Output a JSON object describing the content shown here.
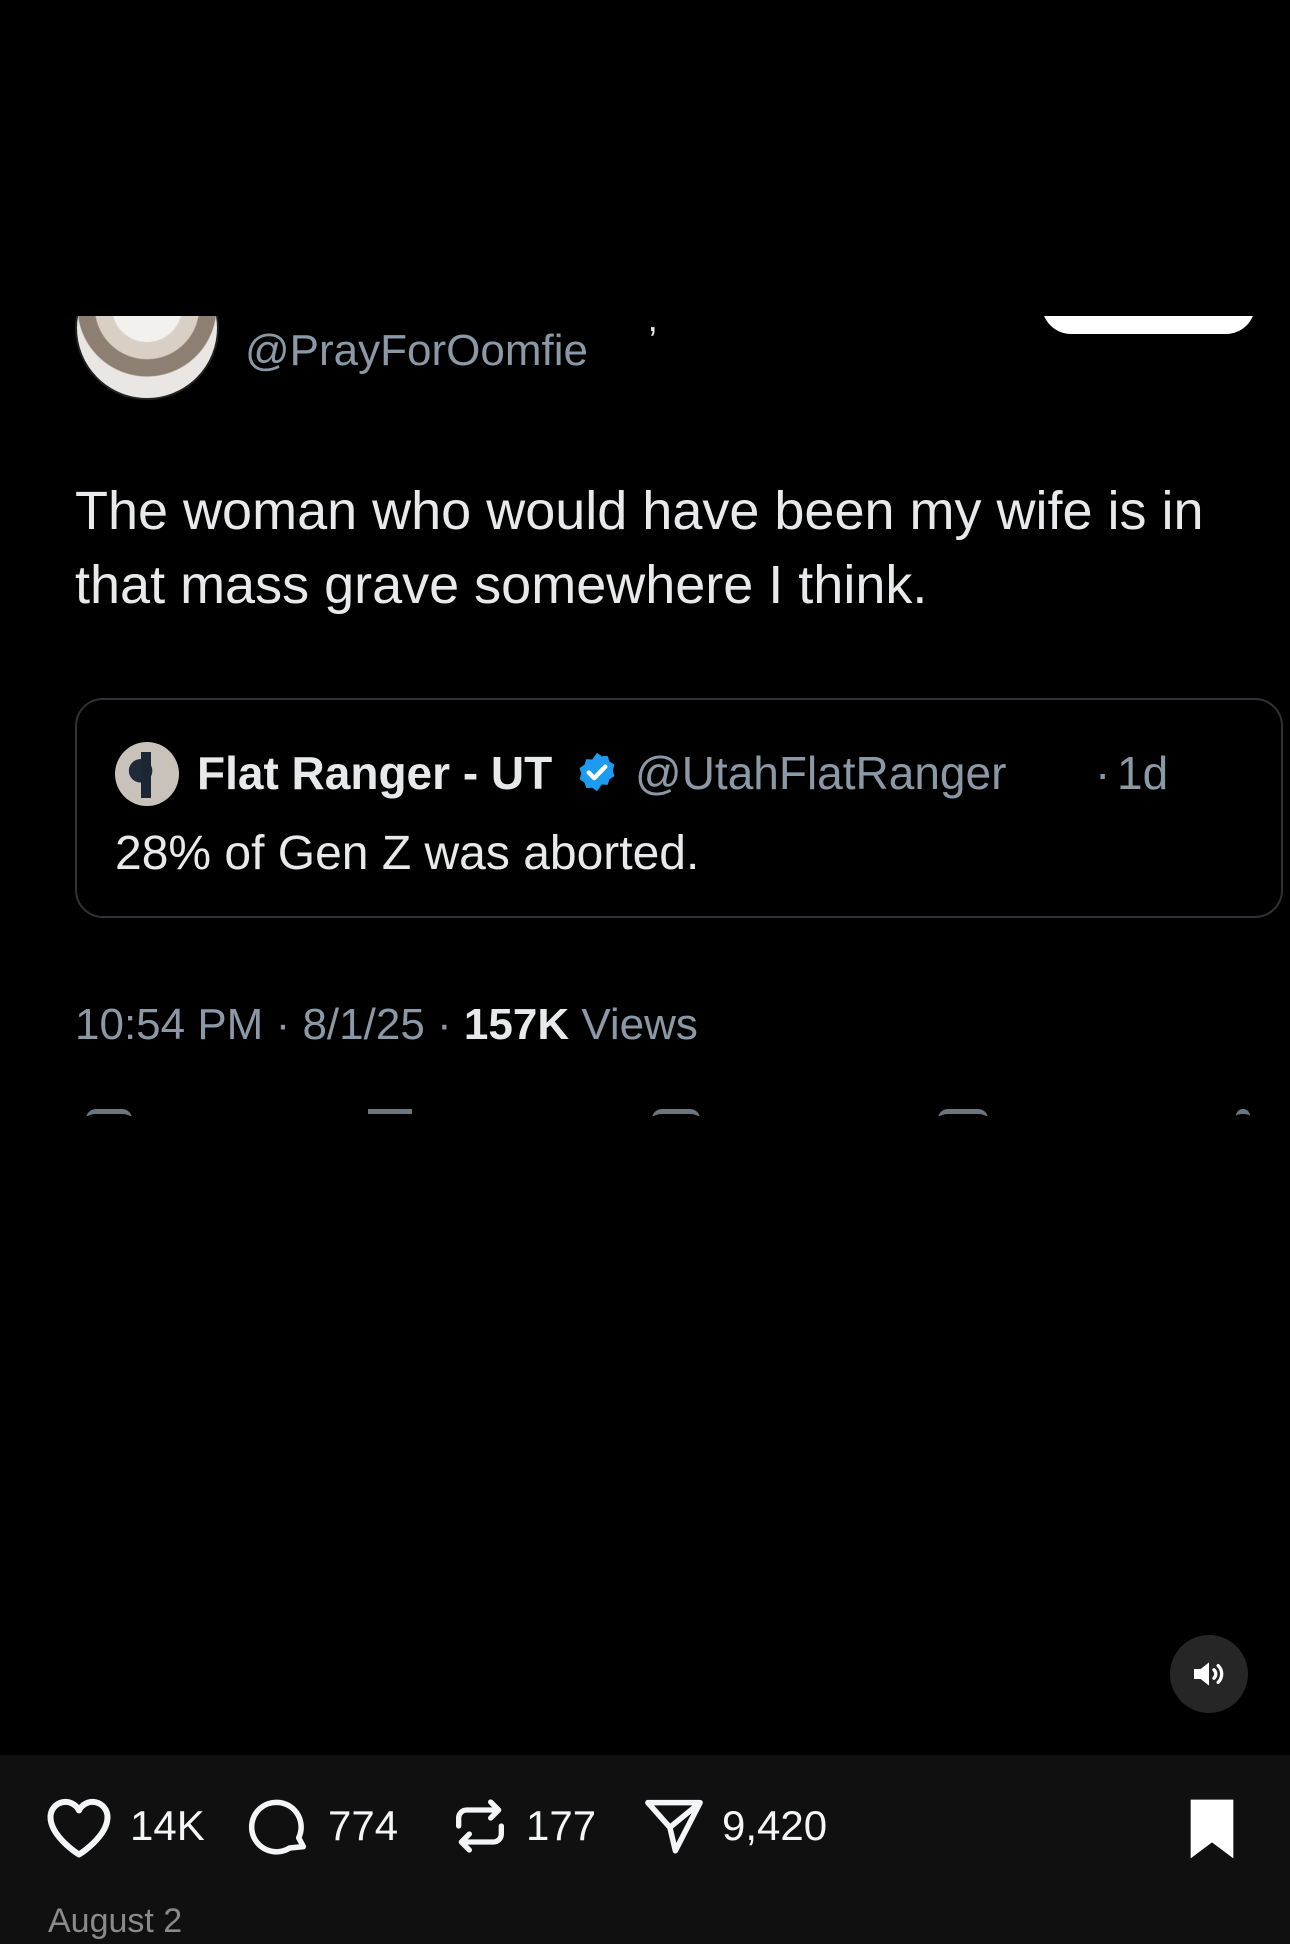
{
  "tweet": {
    "name_fragment": "' ' ,",
    "handle": "@PrayForOomfie",
    "text": "The woman who would have been my wife is in that mass grave somewhere I think.",
    "quote": {
      "name": "Flat Ranger - UT",
      "handle": "@UtahFlatRanger",
      "separator": "·",
      "time": "1d",
      "text": "28% of Gen Z was aborted."
    },
    "meta": {
      "time": "10:54 PM",
      "sep1": " · ",
      "date": "8/1/25",
      "sep2": " · ",
      "views_count": "157K",
      "views_label": " Views"
    }
  },
  "controls": {
    "mute_icon": "speaker-icon"
  },
  "actions": {
    "likes": "14K",
    "replies": "774",
    "reposts": "177",
    "shares": "9,420"
  },
  "post_date": "August 2",
  "colors": {
    "background": "#000000",
    "action_bar": "#101010",
    "text": "#e7e9ea",
    "muted": "#8b98a5",
    "verified": "#1d9bf0"
  }
}
